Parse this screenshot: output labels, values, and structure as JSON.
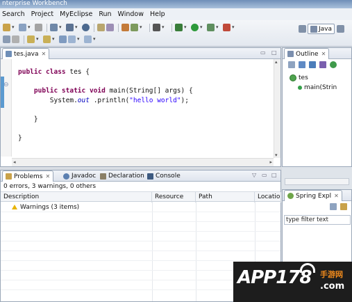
{
  "window": {
    "title": "nterprise Workbench"
  },
  "menu": [
    "Search",
    "Project",
    "MyEclipse",
    "Run",
    "Window",
    "Help"
  ],
  "perspective": {
    "label": "Java"
  },
  "editor": {
    "tab": "tes.java",
    "code": [
      "public class tes {",
      "",
      "    public static void main(String[] args) {",
      "        System.out .println(\"hello world\");",
      "",
      "    }",
      "",
      "}"
    ]
  },
  "outline": {
    "tab": "Outline",
    "tree": {
      "class": "tes",
      "method": "main(Strin"
    }
  },
  "problems": {
    "tabs": [
      "Problems",
      "Javadoc",
      "Declaration",
      "Console"
    ],
    "summary": "0 errors, 3 warnings, 0 others",
    "columns": [
      "Description",
      "Resource",
      "Path",
      "Locatio"
    ],
    "rows": [
      {
        "description": "Warnings (3 items)"
      }
    ]
  },
  "spring": {
    "tab": "Spring Expl",
    "filter_placeholder": "type filter text"
  },
  "watermark": {
    "logo": "APP178",
    "zh": "手游网",
    "suffix": ".com"
  }
}
